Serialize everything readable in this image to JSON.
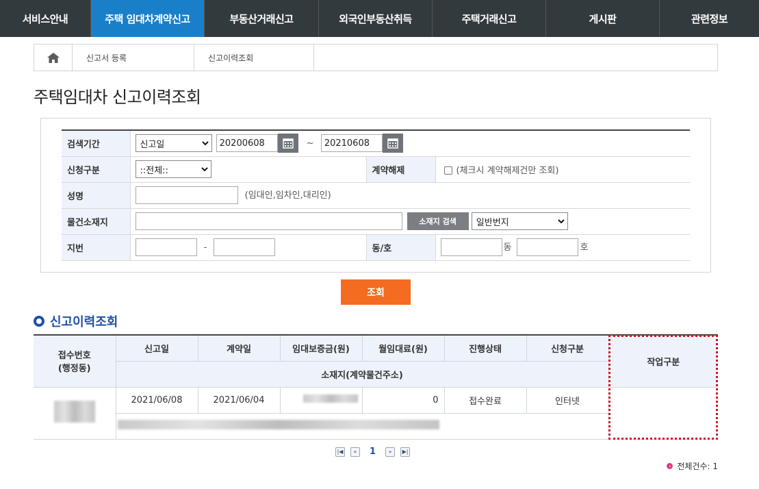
{
  "nav": {
    "items": [
      {
        "label": "서비스안내",
        "width": 133
      },
      {
        "label": "주택 임대차계약신고",
        "width": 166
      },
      {
        "label": "부동산거래신고",
        "width": 167
      },
      {
        "label": "외국인부동산취득",
        "width": 166
      },
      {
        "label": "주택거래신고",
        "width": 166
      },
      {
        "label": "게시판",
        "width": 166
      },
      {
        "label": "관련정보",
        "width": 145
      }
    ],
    "active_index": 1,
    "accent_color": "#1a7fc9"
  },
  "breadcrumb": {
    "home_icon": "home-icon",
    "items": [
      "신고서 등록",
      "신고이력조회"
    ]
  },
  "page_title": "주택임대차 신고이력조회",
  "search": {
    "period_label": "검색기간",
    "period_type": "신고일",
    "date_from": "20200608",
    "date_sep": "~",
    "date_to": "20210608",
    "apply_type_label": "신청구분",
    "apply_type_value": "::전체::",
    "cancel_label": "계약해제",
    "cancel_hint": "(체크시 계약해제건만 조회)",
    "name_label": "성명",
    "name_value": "",
    "name_hint": "(임대인,임차인,대리인)",
    "address_label": "물건소재지",
    "address_value": "",
    "address_search_button": "소재지 검색",
    "address_type": "일반번지",
    "lot_label": "지번",
    "lot_sep": "-",
    "dongho_label": "동/호",
    "dong_suffix": "동",
    "ho_suffix": "호",
    "submit_label": "조회"
  },
  "results": {
    "section_title": "신고이력조회",
    "headers": {
      "receipt_no": "접수번호",
      "receipt_sub": "(행정동)",
      "report_date": "신고일",
      "contract_date": "계약일",
      "deposit": "임대보증금(원)",
      "monthly_rent": "월임대료(원)",
      "status": "진행상태",
      "apply_type": "신청구분",
      "address": "소재지(계약물건주소)",
      "work_type": "작업구분"
    },
    "rows": [
      {
        "report_date": "2021/06/08",
        "contract_date": "2021/06/04",
        "monthly_rent": "0",
        "status": "접수완료",
        "apply_type": "인터넷"
      }
    ]
  },
  "pager": {
    "current_page": "1"
  },
  "total": {
    "label": "전체건수: 1"
  }
}
